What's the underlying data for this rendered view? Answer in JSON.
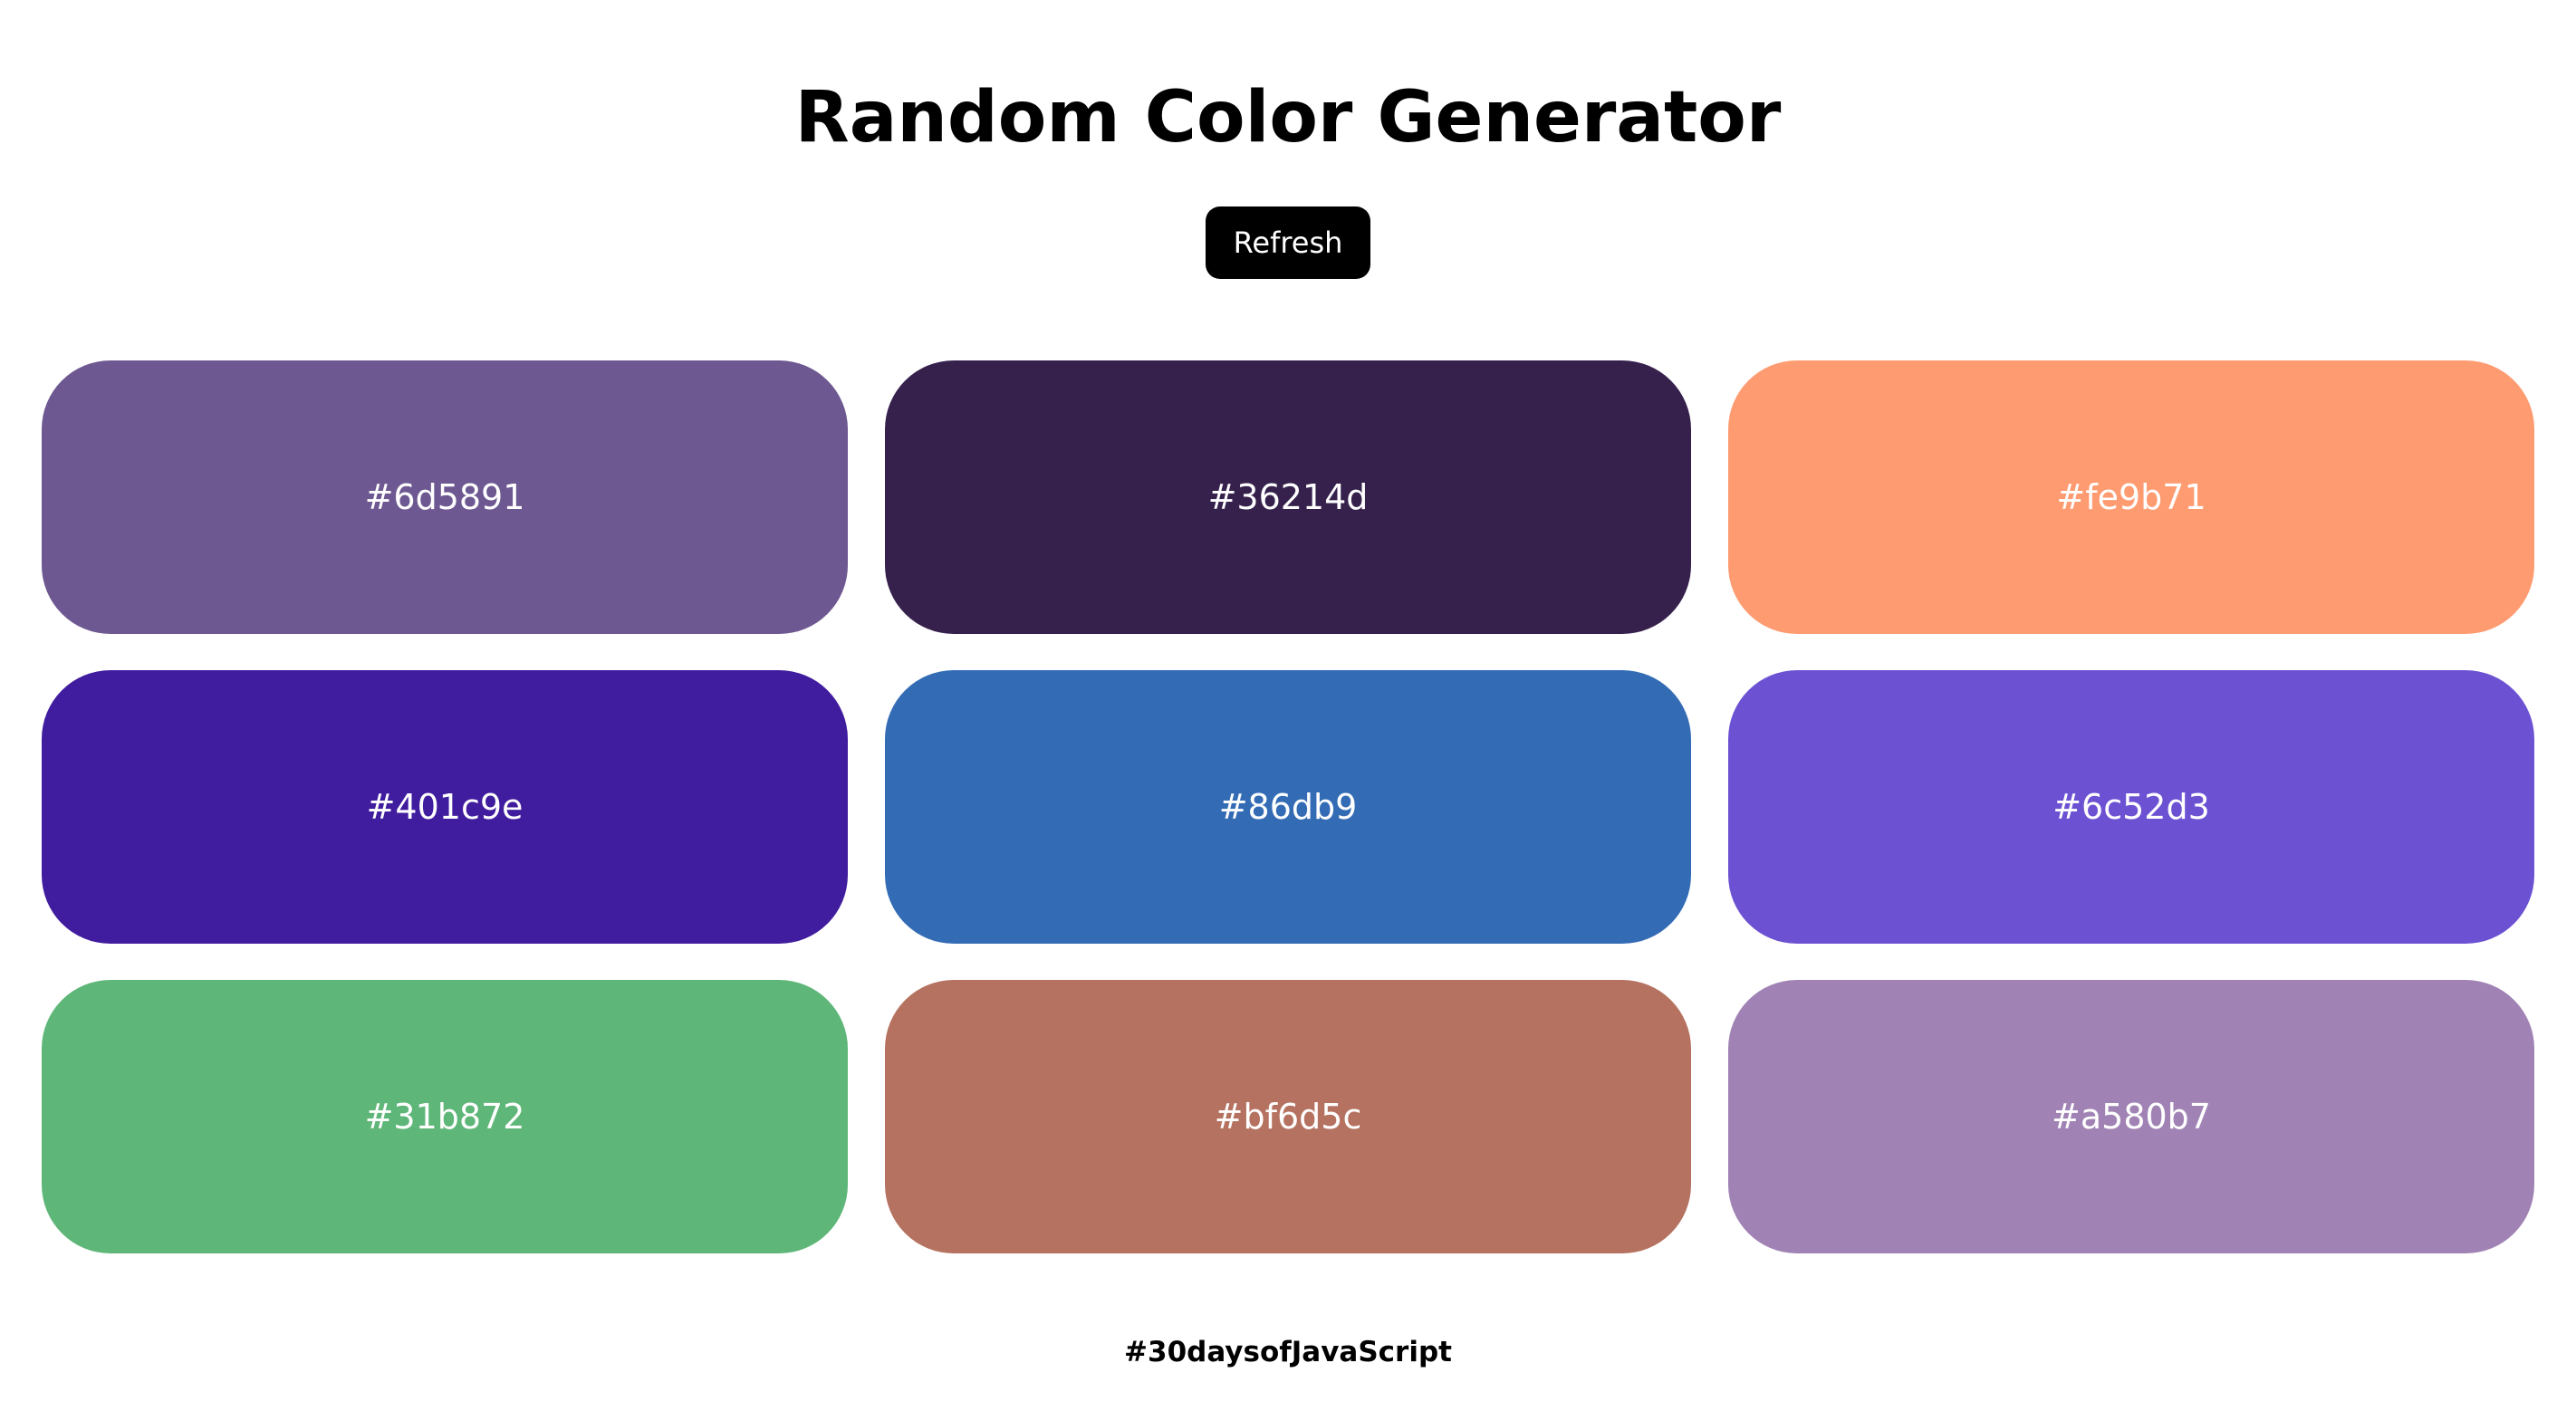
{
  "header": {
    "title": "Random Color Generator",
    "refresh_label": "Refresh"
  },
  "swatches": [
    {
      "hex": "#6d5891",
      "color": "#6d5891"
    },
    {
      "hex": "#36214d",
      "color": "#36214d"
    },
    {
      "hex": "#fe9b71",
      "color": "#fe9b71"
    },
    {
      "hex": "#401c9e",
      "color": "#401c9e"
    },
    {
      "hex": "#86db9",
      "color": "#336cb5"
    },
    {
      "hex": "#6c52d3",
      "color": "#6c52d3"
    },
    {
      "hex": "#31b872",
      "color": "#5eb678"
    },
    {
      "hex": "#bf6d5c",
      "color": "#b57260"
    },
    {
      "hex": "#a580b7",
      "color": "#a083b4"
    }
  ],
  "footer": {
    "text": "#30daysofJavaScript"
  }
}
